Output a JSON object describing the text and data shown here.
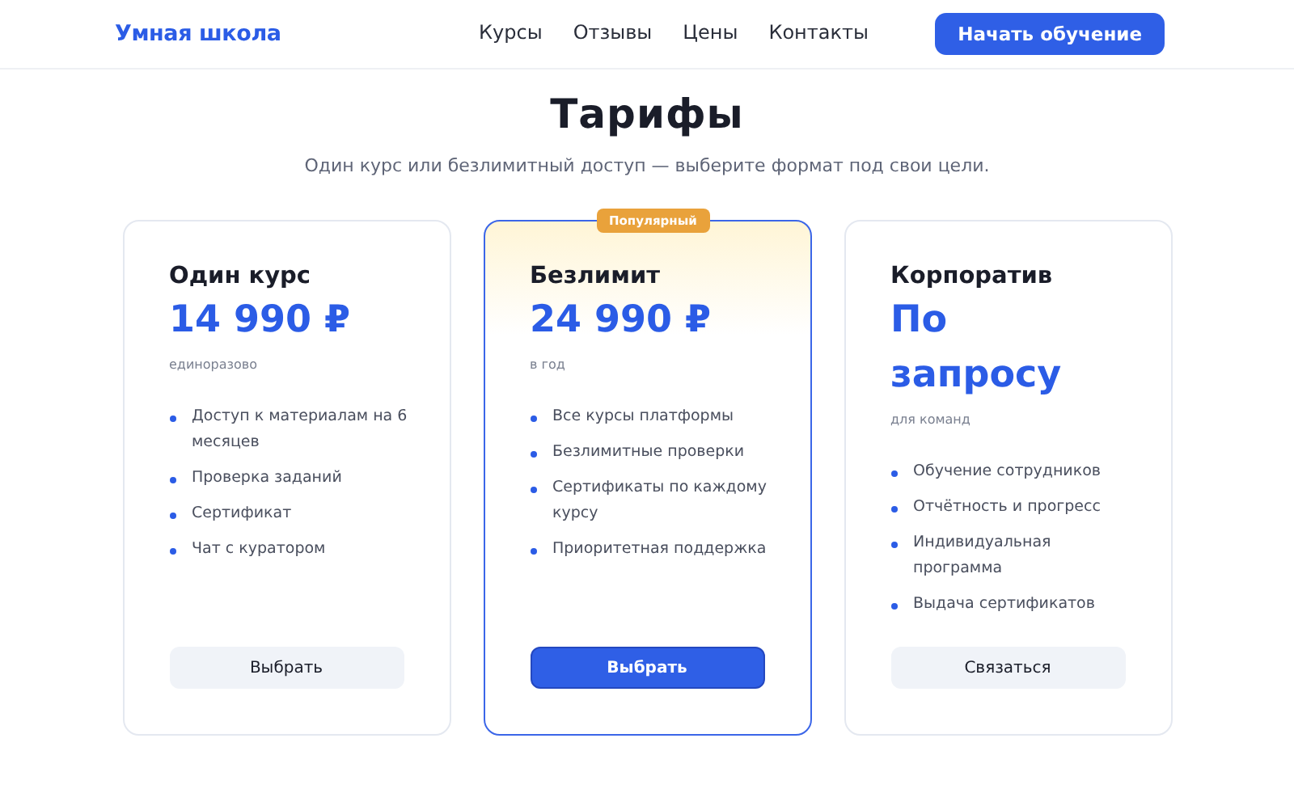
{
  "header": {
    "logo": "Умная школа",
    "nav": [
      "Курсы",
      "Отзывы",
      "Цены",
      "Контакты"
    ],
    "cta": "Начать обучение"
  },
  "title": "Тарифы",
  "subtitle": "Один курс или безлимитный доступ — выберите формат под свои цели.",
  "plans": [
    {
      "name": "Один курс",
      "price": "14 990 ₽",
      "period": "единоразово",
      "featured": false,
      "features": [
        "Доступ к материалам на 6 месяцев",
        "Проверка заданий",
        "Сертификат",
        "Чат с куратором"
      ],
      "button": "Выбрать"
    },
    {
      "name": "Безлимит",
      "price": "24 990 ₽",
      "period": "в год",
      "featured": true,
      "badge": "Популярный",
      "features": [
        "Все курсы платформы",
        "Безлимитные проверки",
        "Сертификаты по каждому курсу",
        "Приоритетная поддержка"
      ],
      "button": "Выбрать"
    },
    {
      "name": "Корпоратив",
      "price": "По запросу",
      "period": "для команд",
      "featured": false,
      "features": [
        "Обучение сотрудников",
        "Отчётность и прогресс",
        "Индивидуальная программа",
        "Выдача сертификатов"
      ],
      "button": "Связаться"
    }
  ]
}
